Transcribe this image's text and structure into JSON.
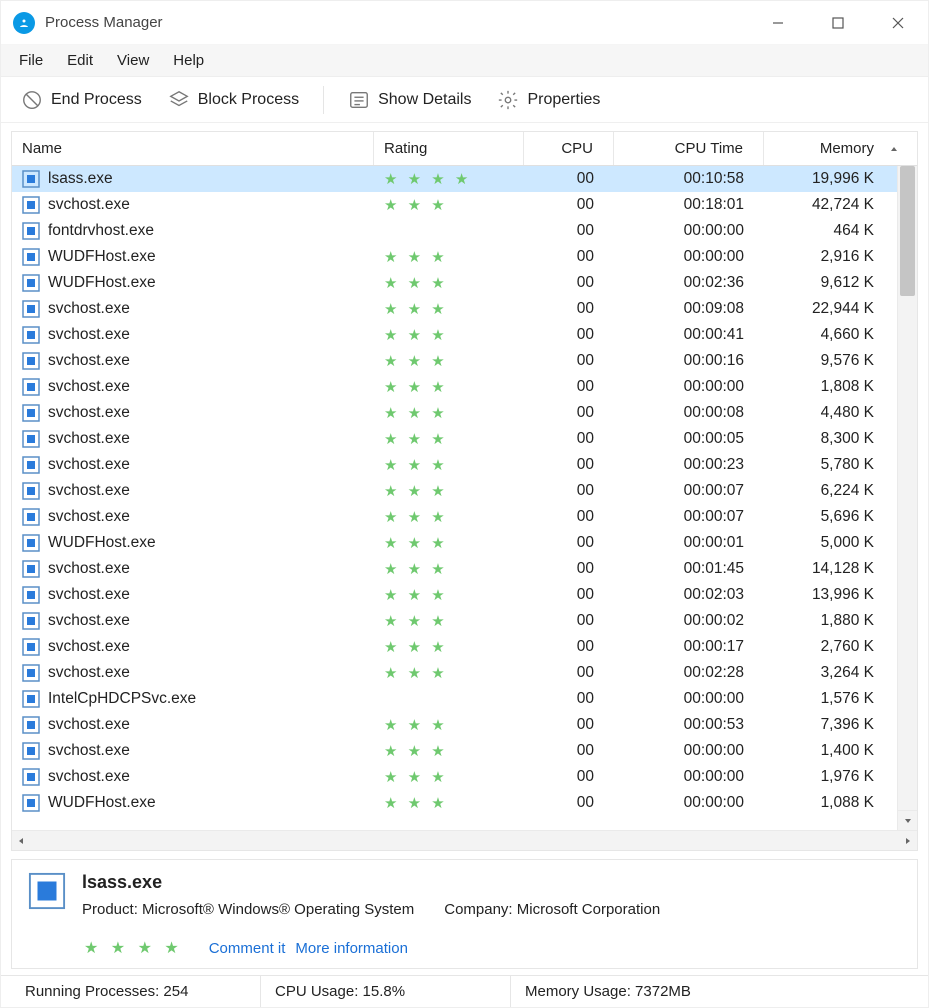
{
  "window_title": "Process Manager",
  "menubar": [
    "File",
    "Edit",
    "View",
    "Help"
  ],
  "toolbar": {
    "end_process": "End Process",
    "block_process": "Block Process",
    "show_details": "Show Details",
    "properties": "Properties"
  },
  "columns": {
    "name": "Name",
    "rating": "Rating",
    "cpu": "CPU",
    "cpu_time": "CPU Time",
    "memory": "Memory"
  },
  "processes": [
    {
      "name": "lsass.exe",
      "rating": 4,
      "cpu": "00",
      "cpu_time": "00:10:58",
      "memory": "19,996 K",
      "selected": true
    },
    {
      "name": "svchost.exe",
      "rating": 3,
      "cpu": "00",
      "cpu_time": "00:18:01",
      "memory": "42,724 K"
    },
    {
      "name": "fontdrvhost.exe",
      "rating": 0,
      "cpu": "00",
      "cpu_time": "00:00:00",
      "memory": "464 K"
    },
    {
      "name": "WUDFHost.exe",
      "rating": 3,
      "cpu": "00",
      "cpu_time": "00:00:00",
      "memory": "2,916 K"
    },
    {
      "name": "WUDFHost.exe",
      "rating": 3,
      "cpu": "00",
      "cpu_time": "00:02:36",
      "memory": "9,612 K"
    },
    {
      "name": "svchost.exe",
      "rating": 3,
      "cpu": "00",
      "cpu_time": "00:09:08",
      "memory": "22,944 K"
    },
    {
      "name": "svchost.exe",
      "rating": 3,
      "cpu": "00",
      "cpu_time": "00:00:41",
      "memory": "4,660 K"
    },
    {
      "name": "svchost.exe",
      "rating": 3,
      "cpu": "00",
      "cpu_time": "00:00:16",
      "memory": "9,576 K"
    },
    {
      "name": "svchost.exe",
      "rating": 3,
      "cpu": "00",
      "cpu_time": "00:00:00",
      "memory": "1,808 K"
    },
    {
      "name": "svchost.exe",
      "rating": 3,
      "cpu": "00",
      "cpu_time": "00:00:08",
      "memory": "4,480 K"
    },
    {
      "name": "svchost.exe",
      "rating": 3,
      "cpu": "00",
      "cpu_time": "00:00:05",
      "memory": "8,300 K"
    },
    {
      "name": "svchost.exe",
      "rating": 3,
      "cpu": "00",
      "cpu_time": "00:00:23",
      "memory": "5,780 K"
    },
    {
      "name": "svchost.exe",
      "rating": 3,
      "cpu": "00",
      "cpu_time": "00:00:07",
      "memory": "6,224 K"
    },
    {
      "name": "svchost.exe",
      "rating": 3,
      "cpu": "00",
      "cpu_time": "00:00:07",
      "memory": "5,696 K"
    },
    {
      "name": "WUDFHost.exe",
      "rating": 3,
      "cpu": "00",
      "cpu_time": "00:00:01",
      "memory": "5,000 K"
    },
    {
      "name": "svchost.exe",
      "rating": 3,
      "cpu": "00",
      "cpu_time": "00:01:45",
      "memory": "14,128 K"
    },
    {
      "name": "svchost.exe",
      "rating": 3,
      "cpu": "00",
      "cpu_time": "00:02:03",
      "memory": "13,996 K"
    },
    {
      "name": "svchost.exe",
      "rating": 3,
      "cpu": "00",
      "cpu_time": "00:00:02",
      "memory": "1,880 K"
    },
    {
      "name": "svchost.exe",
      "rating": 3,
      "cpu": "00",
      "cpu_time": "00:00:17",
      "memory": "2,760 K"
    },
    {
      "name": "svchost.exe",
      "rating": 3,
      "cpu": "00",
      "cpu_time": "00:02:28",
      "memory": "3,264 K"
    },
    {
      "name": "IntelCpHDCPSvc.exe",
      "rating": 0,
      "cpu": "00",
      "cpu_time": "00:00:00",
      "memory": "1,576 K"
    },
    {
      "name": "svchost.exe",
      "rating": 3,
      "cpu": "00",
      "cpu_time": "00:00:53",
      "memory": "7,396 K"
    },
    {
      "name": "svchost.exe",
      "rating": 3,
      "cpu": "00",
      "cpu_time": "00:00:00",
      "memory": "1,400 K"
    },
    {
      "name": "svchost.exe",
      "rating": 3,
      "cpu": "00",
      "cpu_time": "00:00:00",
      "memory": "1,976 K"
    },
    {
      "name": "WUDFHost.exe",
      "rating": 3,
      "cpu": "00",
      "cpu_time": "00:00:00",
      "memory": "1,088 K"
    }
  ],
  "details": {
    "name": "lsass.exe",
    "product_label": "Product:",
    "product_value": "Microsoft® Windows® Operating System",
    "company_label": "Company:",
    "company_value": "Microsoft Corporation",
    "rating": 4,
    "links": {
      "comment": "Comment it",
      "more": "More information"
    }
  },
  "status": {
    "running_label": "Running Processes:",
    "running_value": "254",
    "cpu_label": "CPU Usage:",
    "cpu_value": "15.8%",
    "mem_label": "Memory Usage:",
    "mem_value": "7372MB"
  }
}
